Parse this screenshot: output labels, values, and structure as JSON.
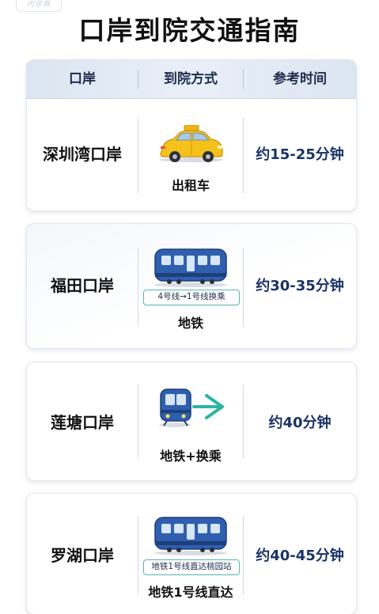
{
  "logo_text": "内容商",
  "title": "口岸到院交通指南",
  "header": {
    "port": "口岸",
    "method": "到院方式",
    "time": "参考时间"
  },
  "rows": [
    {
      "port": "深圳湾口岸",
      "icon": "taxi-icon",
      "tag": "",
      "method": "出租车",
      "time": "约15-25分钟"
    },
    {
      "port": "福田口岸",
      "icon": "train-icon",
      "tag": "4号线→1号线换乘",
      "method": "地铁",
      "time": "约30-35分钟"
    },
    {
      "port": "莲塘口岸",
      "icon": "metro-transfer-icon",
      "tag": "",
      "method": "地铁+换乘",
      "time": "约40分钟"
    },
    {
      "port": "罗湖口岸",
      "icon": "train-icon",
      "tag": "地铁1号线直达桃园站",
      "method": "地铁1号线直达",
      "time": "约40-45分钟"
    }
  ],
  "colors": {
    "train_blue": "#2f5fae",
    "taxi_yellow": "#f5c21b",
    "arrow_teal": "#2bb5a3",
    "time_text": "#1a3366"
  }
}
